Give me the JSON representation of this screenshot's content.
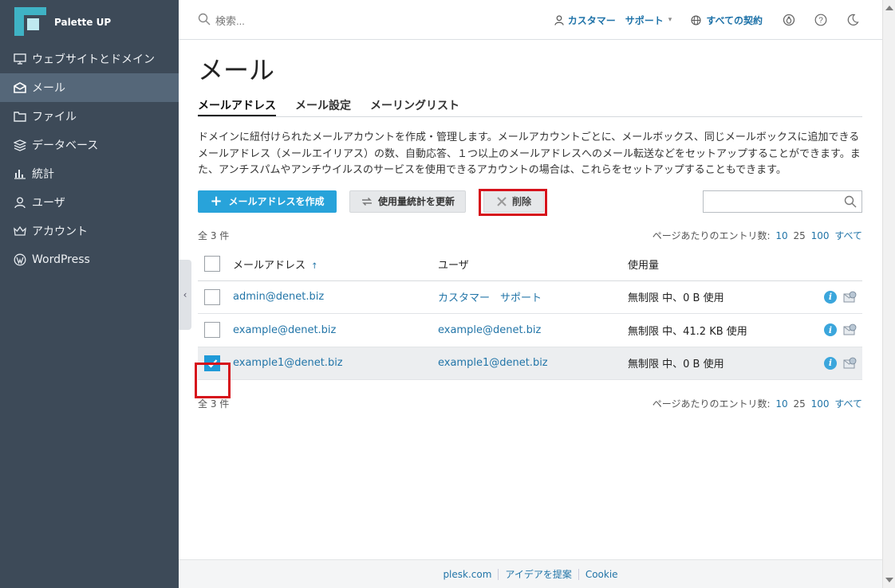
{
  "brand": {
    "name": "Palette UP"
  },
  "sidebar": {
    "items": [
      {
        "label": "ウェブサイトとドメイン",
        "icon": "monitor-icon"
      },
      {
        "label": "メール",
        "icon": "envelope-icon",
        "active": true
      },
      {
        "label": "ファイル",
        "icon": "folder-icon"
      },
      {
        "label": "データベース",
        "icon": "database-icon"
      },
      {
        "label": "統計",
        "icon": "bar-chart-icon"
      },
      {
        "label": "ユーザ",
        "icon": "user-icon"
      },
      {
        "label": "アカウント",
        "icon": "crown-icon"
      },
      {
        "label": "WordPress",
        "icon": "wordpress-icon"
      }
    ]
  },
  "topbar": {
    "search_placeholder": "検索...",
    "user_label": "カスタマー　サポート",
    "subscriptions_label": "すべての契約"
  },
  "main": {
    "title": "メール",
    "tabs": [
      {
        "label": "メールアドレス",
        "active": true
      },
      {
        "label": "メール設定"
      },
      {
        "label": "メーリングリスト"
      }
    ],
    "description": "ドメインに紐付けられたメールアカウントを作成・管理します。メールアカウントごとに、メールボックス、同じメールボックスに追加できるメールアドレス（メールエイリアス）の数、自動応答、１つ以上のメールアドレスへのメール転送などをセットアップすることができます。また、アンチスパムやアンチウイルスのサービスを使用できるアカウントの場合は、これらをセットアップすることもできます。",
    "toolbar": {
      "create_label": "メールアドレスを作成",
      "refresh_label": "使用量統計を更新",
      "delete_label": "削除"
    },
    "count_label": "全 3 件",
    "per_page_label": "ページあたりのエントリ数:",
    "per_page_options": [
      "10",
      "25",
      "100",
      "すべて"
    ],
    "table": {
      "headers": {
        "email": "メールアドレス",
        "user": "ユーザ",
        "usage": "使用量"
      },
      "rows": [
        {
          "email": "admin@denet.biz",
          "user": "カスタマー　サポート",
          "usage": "無制限 中、0 B 使用",
          "checked": false
        },
        {
          "email": "example@denet.biz",
          "user": "example@denet.biz",
          "usage": "無制限 中、41.2 KB 使用",
          "checked": false
        },
        {
          "email": "example1@denet.biz",
          "user": "example1@denet.biz",
          "usage": "無制限 中、0 B 使用",
          "checked": true
        }
      ]
    }
  },
  "footer": {
    "links": [
      "plesk.com",
      "アイデアを提案",
      "Cookie"
    ]
  },
  "colors": {
    "sidebar_bg": "#3d4a58",
    "accent": "#28a3da",
    "link": "#2275a8",
    "highlight_red": "#d6121b"
  }
}
